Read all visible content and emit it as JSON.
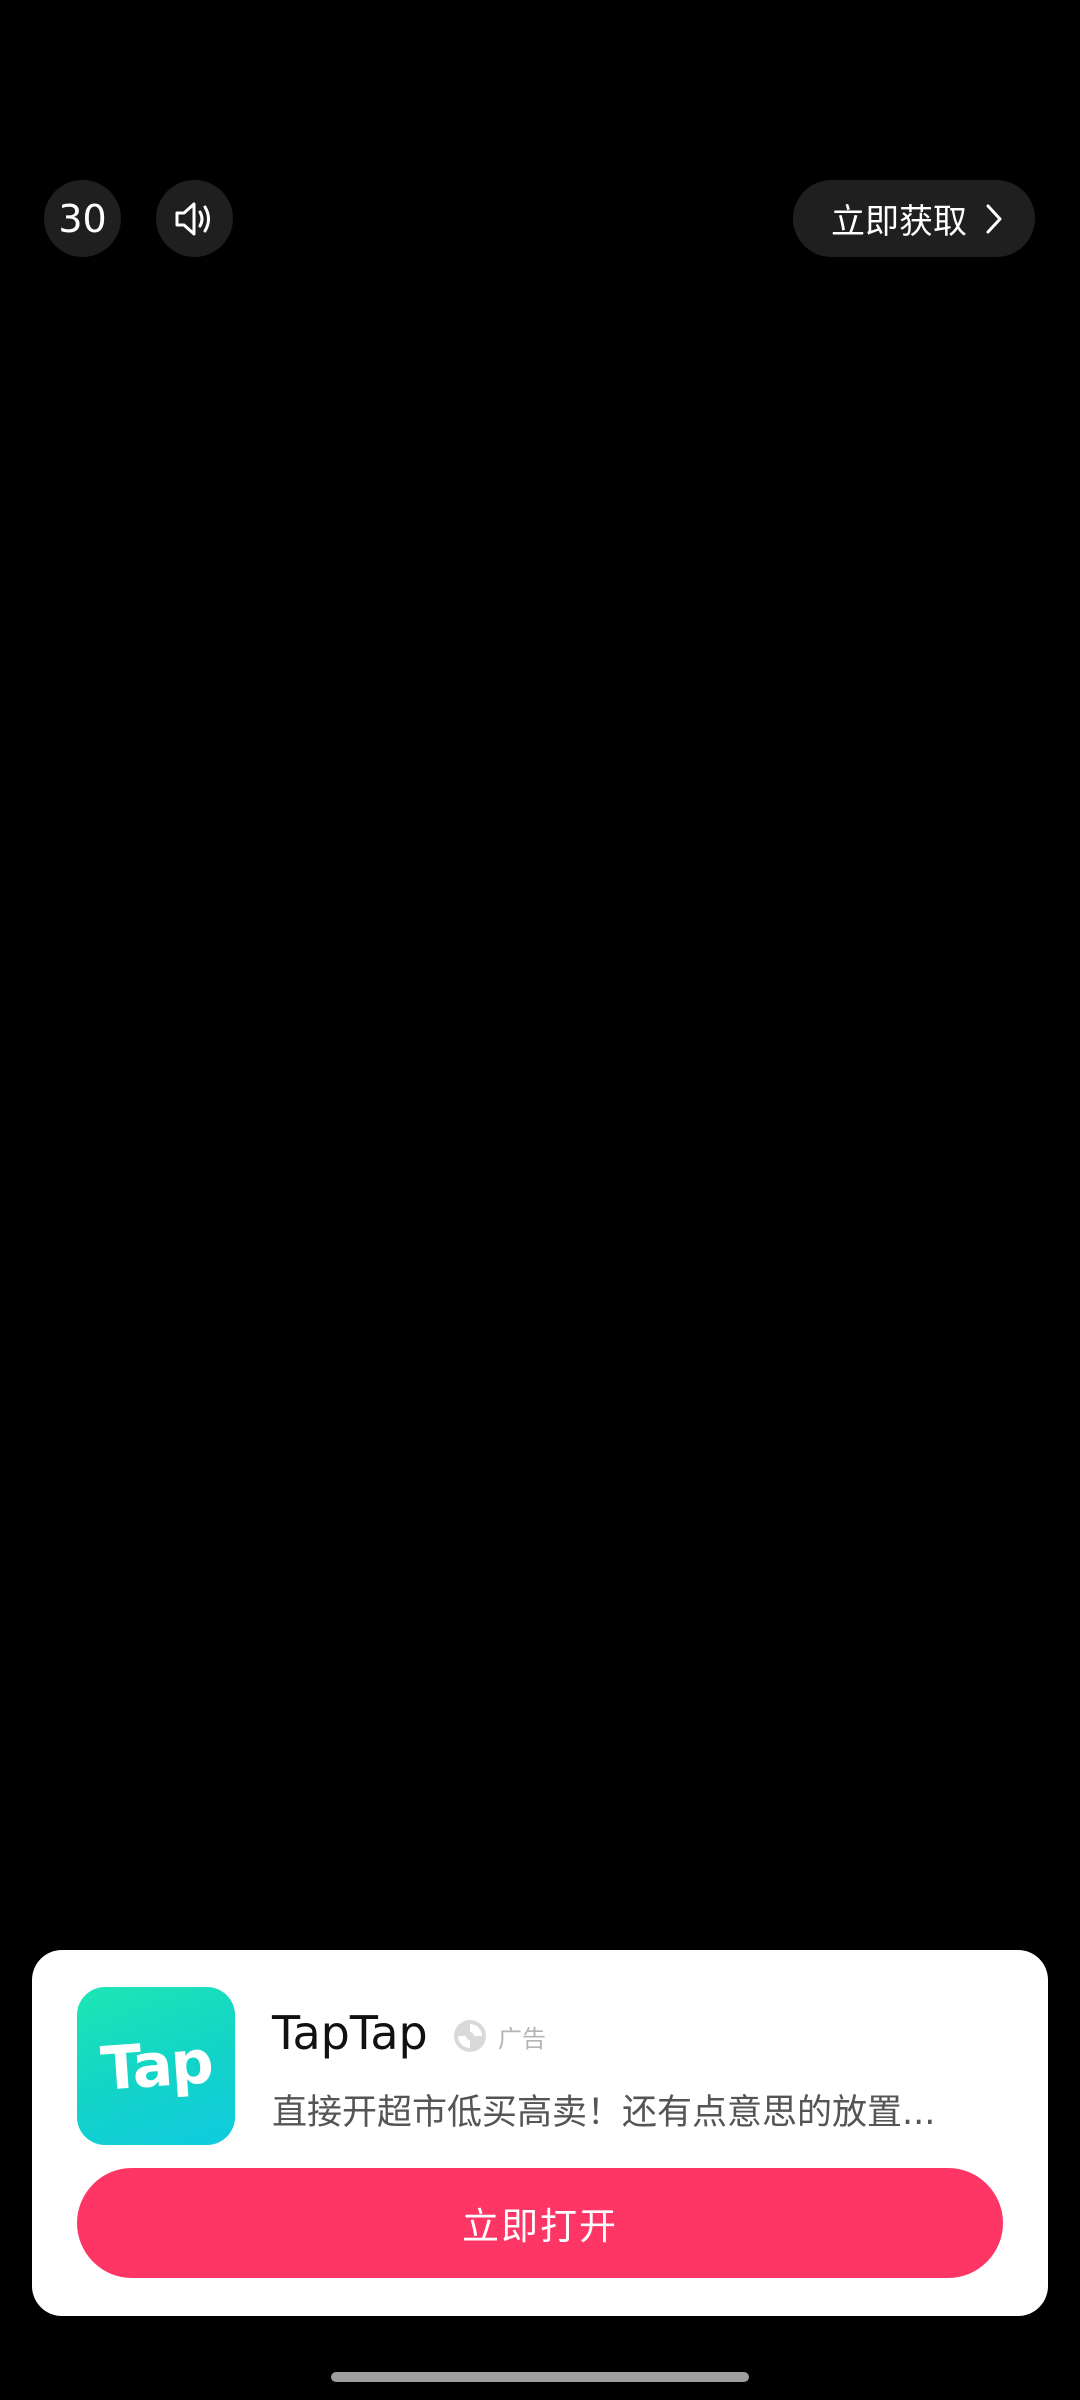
{
  "overlay": {
    "countdown": "30",
    "sound_icon": "speaker-icon",
    "get_button_label": "立即获取",
    "get_button_icon": "chevron-right-icon"
  },
  "ad_card": {
    "app_icon": "taptap-logo-icon",
    "app_icon_text": "Tap",
    "app_name": "TapTap",
    "ad_badge_icon": "ad-source-icon",
    "ad_badge_label": "广告",
    "description": "直接开超市低买高卖！还有点意思的放置...",
    "open_button_label": "立即打开"
  },
  "colors": {
    "background": "#000000",
    "overlay_button": "#1f1f1f",
    "primary_button": "#fe3666",
    "icon_gradient_start": "#1ee6b4",
    "icon_gradient_end": "#10cbe0"
  }
}
